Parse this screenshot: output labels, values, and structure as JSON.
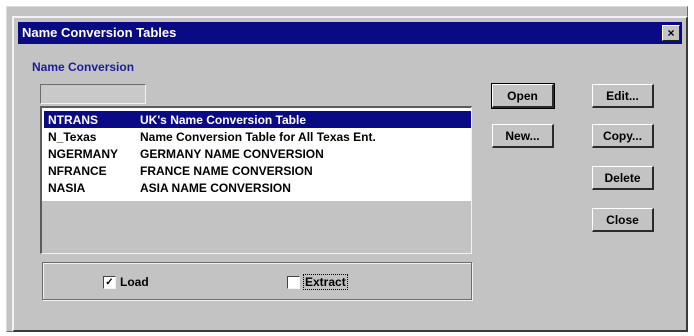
{
  "window": {
    "title": "Name Conversion Tables",
    "close_glyph": "×"
  },
  "group_label": "Name Conversion",
  "list": {
    "items": [
      {
        "code": "NTRANS",
        "description": "UK's Name Conversion  Table",
        "selected": true
      },
      {
        "code": "N_Texas",
        "description": "Name Conversion Table for All Texas Ent.",
        "selected": false
      },
      {
        "code": "NGERMANY",
        "description": "GERMANY NAME CONVERSION",
        "selected": false
      },
      {
        "code": "NFRANCE",
        "description": "FRANCE NAME CONVERSION",
        "selected": false
      },
      {
        "code": "NASIA",
        "description": "ASIA NAME CONVERSION",
        "selected": false
      }
    ]
  },
  "options": {
    "load": {
      "label": "Load",
      "checked": true,
      "mark": "✓"
    },
    "extract": {
      "label": "Extract",
      "checked": false
    }
  },
  "buttons": {
    "open": "Open",
    "edit": "Edit...",
    "new": "New...",
    "copy": "Copy...",
    "delete": "Delete",
    "close": "Close"
  },
  "colors": {
    "titlebar": "#0a0a84",
    "selection": "#0a0a84",
    "group_label": "#1c1c9c",
    "face": "#c3c3c3"
  }
}
